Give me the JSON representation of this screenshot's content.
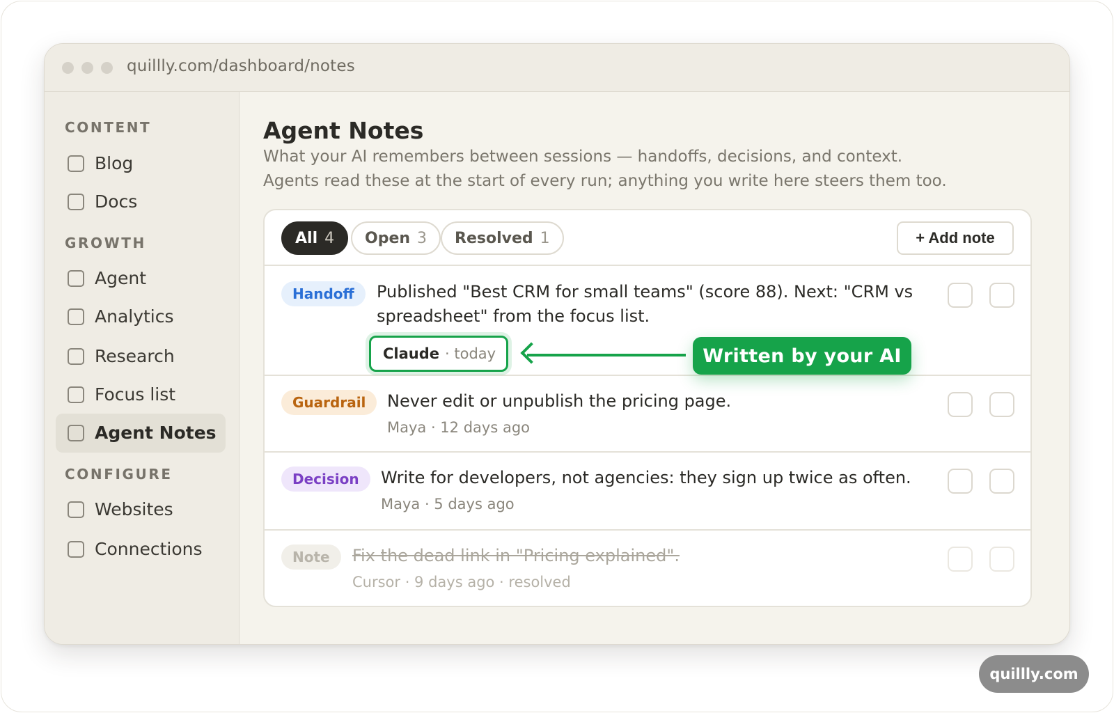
{
  "browser": {
    "url": "quillly.com/dashboard/notes"
  },
  "sidebar": {
    "sections": [
      {
        "heading": "CONTENT",
        "items": [
          {
            "label": "Blog"
          },
          {
            "label": "Docs"
          }
        ]
      },
      {
        "heading": "GROWTH",
        "items": [
          {
            "label": "Agent"
          },
          {
            "label": "Analytics"
          },
          {
            "label": "Research"
          },
          {
            "label": "Focus list"
          },
          {
            "label": "Agent Notes",
            "active": true
          }
        ]
      },
      {
        "heading": "CONFIGURE",
        "items": [
          {
            "label": "Websites"
          },
          {
            "label": "Connections"
          }
        ]
      }
    ]
  },
  "main": {
    "title": "Agent Notes",
    "subtitle_line1": "What your AI remembers between sessions — handoffs, decisions, and context.",
    "subtitle_line2": "Agents read these at the start of every run; anything you write here steers them too.",
    "filters": [
      {
        "label": "All",
        "count": "4",
        "active": true
      },
      {
        "label": "Open",
        "count": "3"
      },
      {
        "label": "Resolved",
        "count": "1"
      }
    ],
    "add_note_label": "+ Add note",
    "notes": [
      {
        "tag": "Handoff",
        "text_line1": "Published \"Best CRM for small teams\" (score 88). Next: \"CRM vs",
        "text_line2": "spreadsheet\" from the focus list.",
        "author": "Claude",
        "when": "· today"
      },
      {
        "tag": "Guardrail",
        "text": "Never edit or unpublish the pricing page.",
        "meta": "Maya · 12 days ago"
      },
      {
        "tag": "Decision",
        "text": "Write for developers, not agencies: they sign up twice as often.",
        "meta": "Maya · 5 days ago"
      },
      {
        "tag": "Note",
        "text": "Fix the dead link in \"Pricing explained\".",
        "meta": "Cursor · 9 days ago · resolved",
        "resolved": true
      }
    ]
  },
  "callout": {
    "label": "Written by your AI",
    "color": "#16a34a"
  },
  "brand_badge": "quillly.com"
}
